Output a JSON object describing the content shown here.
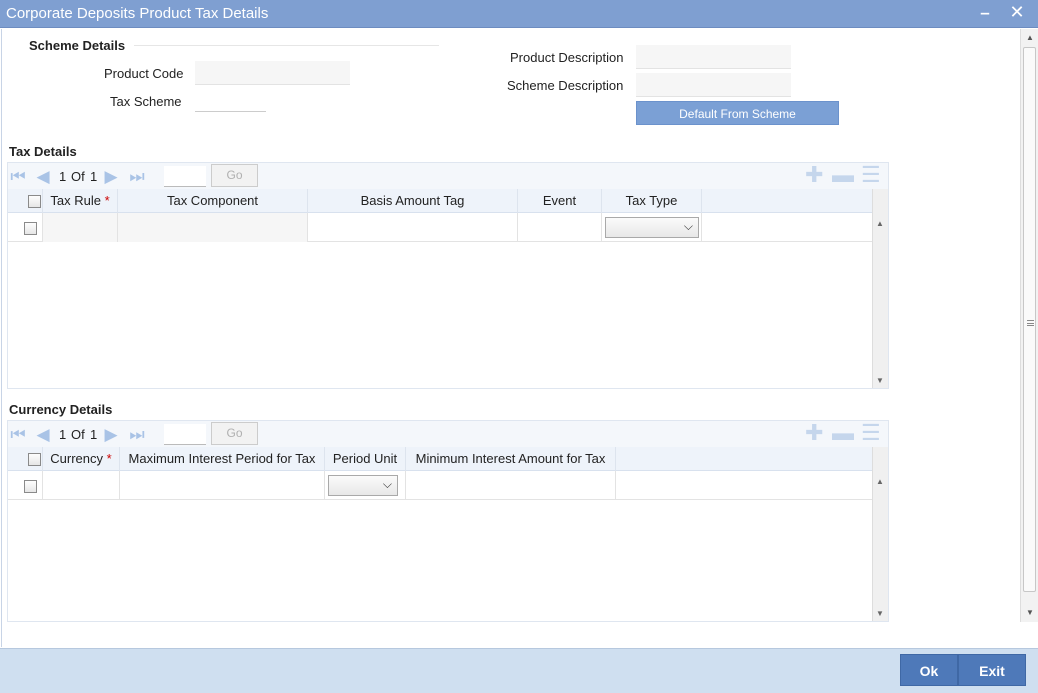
{
  "window": {
    "title": "Corporate Deposits Product Tax Details",
    "minimize_glyph": "▬",
    "close_glyph": "✕"
  },
  "scheme_details": {
    "section_label": "Scheme Details",
    "product_code_label": "Product Code",
    "product_code_value": "",
    "tax_scheme_label": "Tax Scheme",
    "tax_scheme_value": "",
    "product_description_label": "Product Description",
    "product_description_value": "",
    "scheme_description_label": "Scheme Description",
    "scheme_description_value": "",
    "default_button": "Default From Scheme"
  },
  "tax_details": {
    "section_label": "Tax Details",
    "page_current": "1",
    "page_of": "Of",
    "page_total": "1",
    "go_label": "Go",
    "columns": [
      "Tax Rule",
      "Tax Component",
      "Basis Amount Tag",
      "Event",
      "Tax Type"
    ],
    "required_marker": "*"
  },
  "currency_details": {
    "section_label": "Currency Details",
    "page_current": "1",
    "page_of": "Of",
    "page_total": "1",
    "go_label": "Go",
    "columns": [
      "Currency",
      "Maximum Interest Period for Tax",
      "Period Unit",
      "Minimum Interest Amount for Tax"
    ],
    "required_marker": "*"
  },
  "footer": {
    "ok_label": "Ok",
    "exit_label": "Exit"
  },
  "icons": {
    "first": "first-page-icon",
    "prev": "prev-page-icon",
    "next": "next-page-icon",
    "last": "last-page-icon",
    "add": "add-row-icon",
    "delete": "delete-row-icon",
    "view": "single-view-icon"
  }
}
